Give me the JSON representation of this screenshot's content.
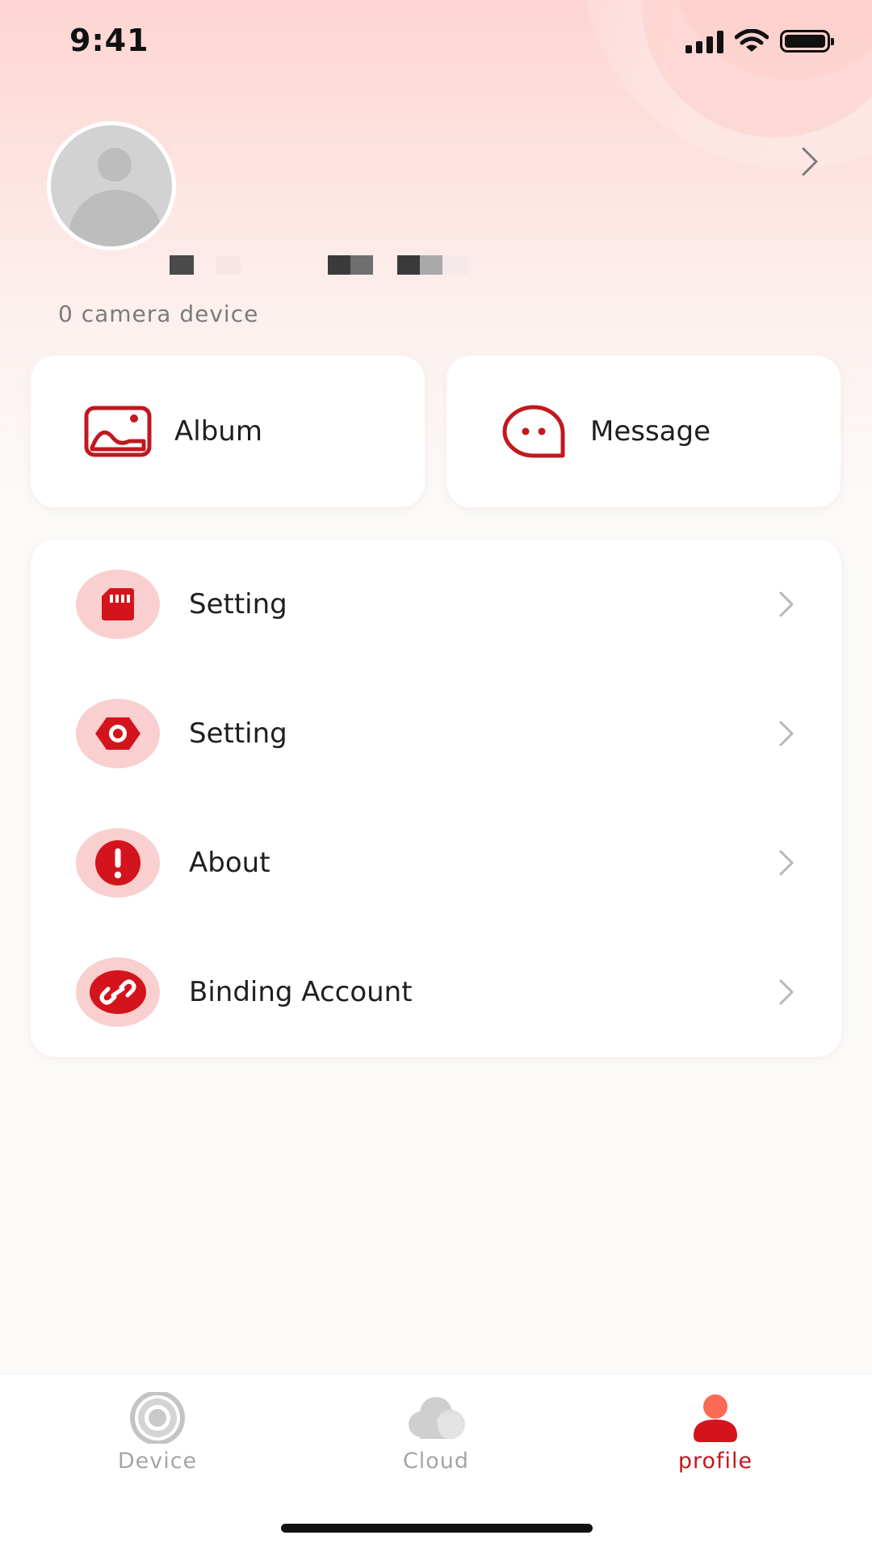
{
  "status_bar": {
    "time": "9:41"
  },
  "profile": {
    "device_count": "0 camera device"
  },
  "quick_actions": [
    {
      "label": "Album",
      "icon": "album-icon"
    },
    {
      "label": "Message",
      "icon": "message-icon"
    }
  ],
  "menu": {
    "items": [
      {
        "label": "Setting",
        "icon": "sd-card-icon"
      },
      {
        "label": "Setting",
        "icon": "camera-lens-icon"
      },
      {
        "label": "About",
        "icon": "exclamation-icon"
      },
      {
        "label": "Binding Account",
        "icon": "link-icon"
      }
    ]
  },
  "tabbar": {
    "tabs": [
      {
        "label": "Device",
        "icon": "camera-icon",
        "active": false
      },
      {
        "label": "Cloud",
        "icon": "cloud-icon",
        "active": false
      },
      {
        "label": "profile",
        "icon": "person-icon",
        "active": true
      }
    ]
  },
  "colors": {
    "accent": "#c0191f",
    "icon_bg": "#f9cfd0",
    "inactive": "#a5a5a5"
  }
}
